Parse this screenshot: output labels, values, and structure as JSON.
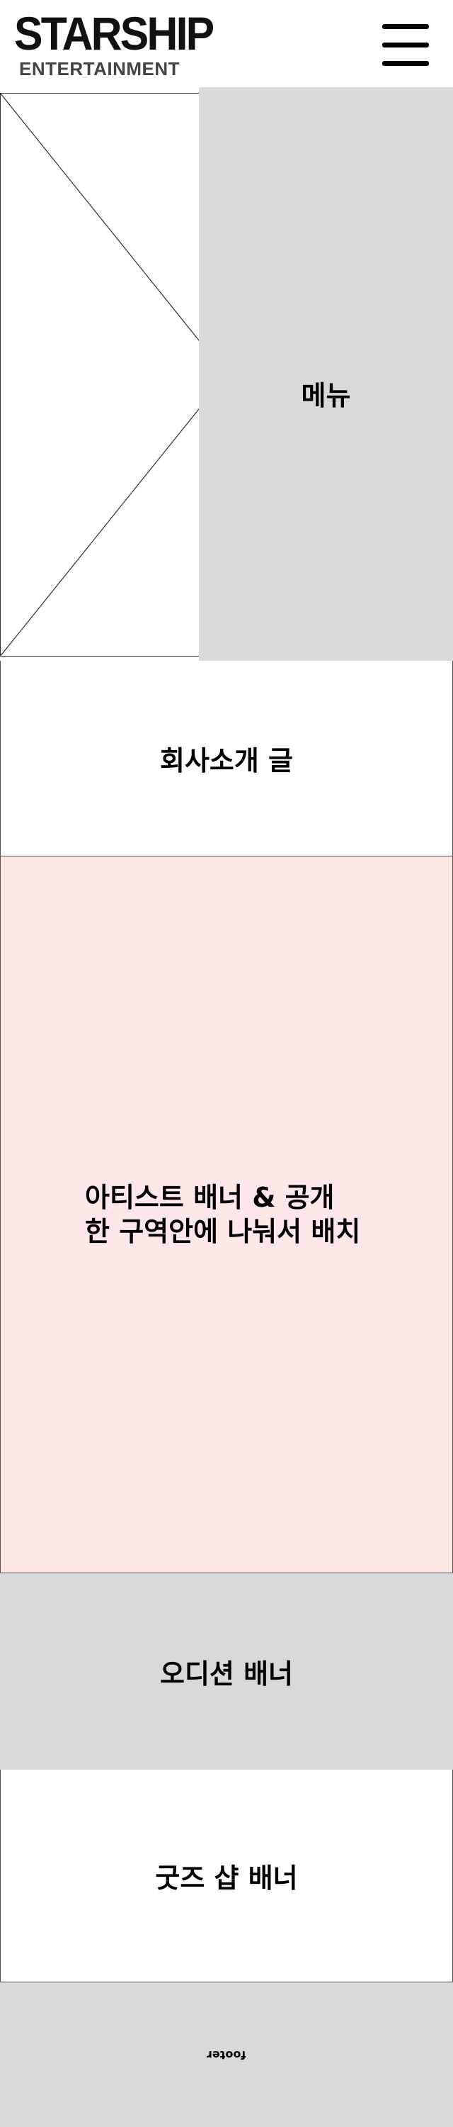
{
  "header": {
    "logo_main": "STARSHIP",
    "logo_sub": "ENTERTAINMENT"
  },
  "icons": {
    "menu": "hamburger-icon"
  },
  "menu_panel": {
    "label": "메뉴"
  },
  "sections": {
    "company_intro": "회사소개 글",
    "artist_line1": "아티스트 배너 & 공개",
    "artist_line2": "한 구역안에 나눠서 배치",
    "audition": "오디션 배너",
    "goods": "굿즈 샵 배너"
  },
  "footer": {
    "label": "footer"
  },
  "colors": {
    "panel_gray": "#d9d9d9",
    "artist_pink": "#fde7e7",
    "background": "#ffffff"
  }
}
